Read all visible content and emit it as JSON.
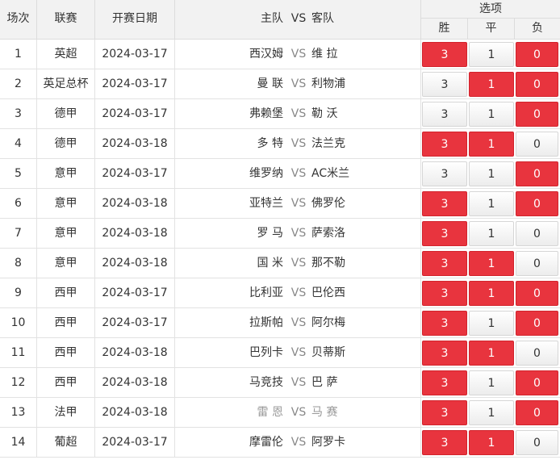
{
  "header": {
    "no": "场次",
    "league": "联赛",
    "date": "开赛日期",
    "home": "主队",
    "vs": "VS",
    "away": "客队",
    "options": "选项",
    "win": "胜",
    "draw": "平",
    "lose": "负"
  },
  "colors": {
    "selected": "#e8343e",
    "header_bg": "#f2f2f2"
  },
  "matches": [
    {
      "no": "1",
      "league": "英超",
      "date": "2024-03-17",
      "home": "西汉姆",
      "away": "维 拉",
      "win": "3",
      "draw": "1",
      "lose": "0",
      "sel": [
        "win",
        "lose"
      ],
      "dim": false
    },
    {
      "no": "2",
      "league": "英足总杯",
      "date": "2024-03-17",
      "home": "曼 联",
      "away": "利物浦",
      "win": "3",
      "draw": "1",
      "lose": "0",
      "sel": [
        "draw",
        "lose"
      ],
      "dim": false
    },
    {
      "no": "3",
      "league": "德甲",
      "date": "2024-03-17",
      "home": "弗赖堡",
      "away": "勒 沃",
      "win": "3",
      "draw": "1",
      "lose": "0",
      "sel": [
        "lose"
      ],
      "dim": false
    },
    {
      "no": "4",
      "league": "德甲",
      "date": "2024-03-18",
      "home": "多 特",
      "away": "法兰克",
      "win": "3",
      "draw": "1",
      "lose": "0",
      "sel": [
        "win",
        "draw"
      ],
      "dim": false
    },
    {
      "no": "5",
      "league": "意甲",
      "date": "2024-03-17",
      "home": "维罗纳",
      "away": "AC米兰",
      "win": "3",
      "draw": "1",
      "lose": "0",
      "sel": [
        "lose"
      ],
      "dim": false
    },
    {
      "no": "6",
      "league": "意甲",
      "date": "2024-03-18",
      "home": "亚特兰",
      "away": "佛罗伦",
      "win": "3",
      "draw": "1",
      "lose": "0",
      "sel": [
        "win",
        "lose"
      ],
      "dim": false
    },
    {
      "no": "7",
      "league": "意甲",
      "date": "2024-03-18",
      "home": "罗 马",
      "away": "萨索洛",
      "win": "3",
      "draw": "1",
      "lose": "0",
      "sel": [
        "win"
      ],
      "dim": false
    },
    {
      "no": "8",
      "league": "意甲",
      "date": "2024-03-18",
      "home": "国 米",
      "away": "那不勒",
      "win": "3",
      "draw": "1",
      "lose": "0",
      "sel": [
        "win",
        "draw"
      ],
      "dim": false
    },
    {
      "no": "9",
      "league": "西甲",
      "date": "2024-03-17",
      "home": "比利亚",
      "away": "巴伦西",
      "win": "3",
      "draw": "1",
      "lose": "0",
      "sel": [
        "win",
        "draw",
        "lose"
      ],
      "dim": false
    },
    {
      "no": "10",
      "league": "西甲",
      "date": "2024-03-17",
      "home": "拉斯帕",
      "away": "阿尔梅",
      "win": "3",
      "draw": "1",
      "lose": "0",
      "sel": [
        "win",
        "lose"
      ],
      "dim": false
    },
    {
      "no": "11",
      "league": "西甲",
      "date": "2024-03-18",
      "home": "巴列卡",
      "away": "贝蒂斯",
      "win": "3",
      "draw": "1",
      "lose": "0",
      "sel": [
        "win",
        "draw"
      ],
      "dim": false
    },
    {
      "no": "12",
      "league": "西甲",
      "date": "2024-03-18",
      "home": "马竞技",
      "away": "巴 萨",
      "win": "3",
      "draw": "1",
      "lose": "0",
      "sel": [
        "win",
        "lose"
      ],
      "dim": false
    },
    {
      "no": "13",
      "league": "法甲",
      "date": "2024-03-18",
      "home": "雷 恩",
      "away": "马 赛",
      "win": "3",
      "draw": "1",
      "lose": "0",
      "sel": [
        "win",
        "lose"
      ],
      "dim": true
    },
    {
      "no": "14",
      "league": "葡超",
      "date": "2024-03-17",
      "home": "摩雷伦",
      "away": "阿罗卡",
      "win": "3",
      "draw": "1",
      "lose": "0",
      "sel": [
        "win",
        "draw"
      ],
      "dim": false
    }
  ]
}
